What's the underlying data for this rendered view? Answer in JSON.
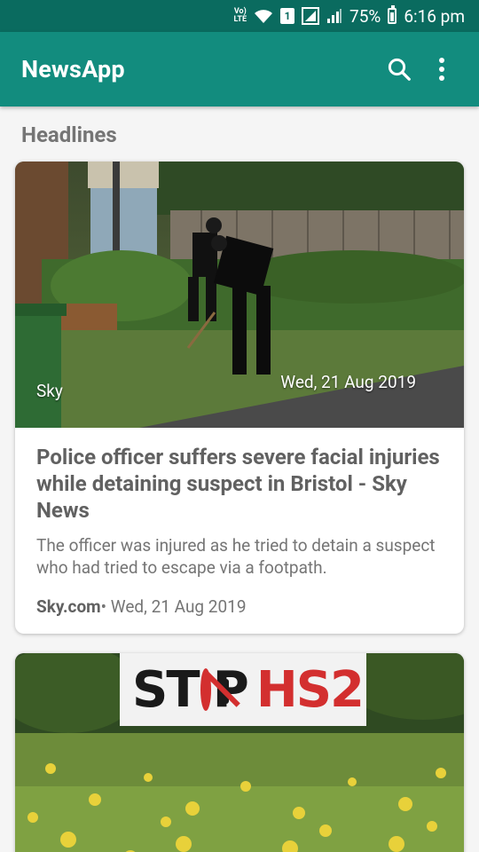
{
  "status_bar": {
    "network_label": "Vo) LTE",
    "sim_slot": "1",
    "battery": "75%",
    "time": "6:16 pm"
  },
  "app_bar": {
    "title": "NewsApp",
    "search_icon": "search-icon",
    "more_icon": "more-vert-icon",
    "background": "#128c7e",
    "status_background": "#0a6b5f"
  },
  "section": {
    "title": "Headlines"
  },
  "articles": [
    {
      "image_source": "Sky",
      "image_date": "Wed, 21 Aug 2019",
      "title": "Police officer suffers severe facial injuries while detaining suspect in Bristol - Sky News",
      "description": "The officer was injured as he tried to detain a suspect who had tried to escape via a footpath.",
      "meta_source": "Sky.com",
      "meta_sep": "• ",
      "meta_date": "Wed, 21 Aug 2019"
    },
    {
      "banner_text_left": "ST",
      "banner_text_mid": "P",
      "banner_text_right": "HS2"
    }
  ]
}
